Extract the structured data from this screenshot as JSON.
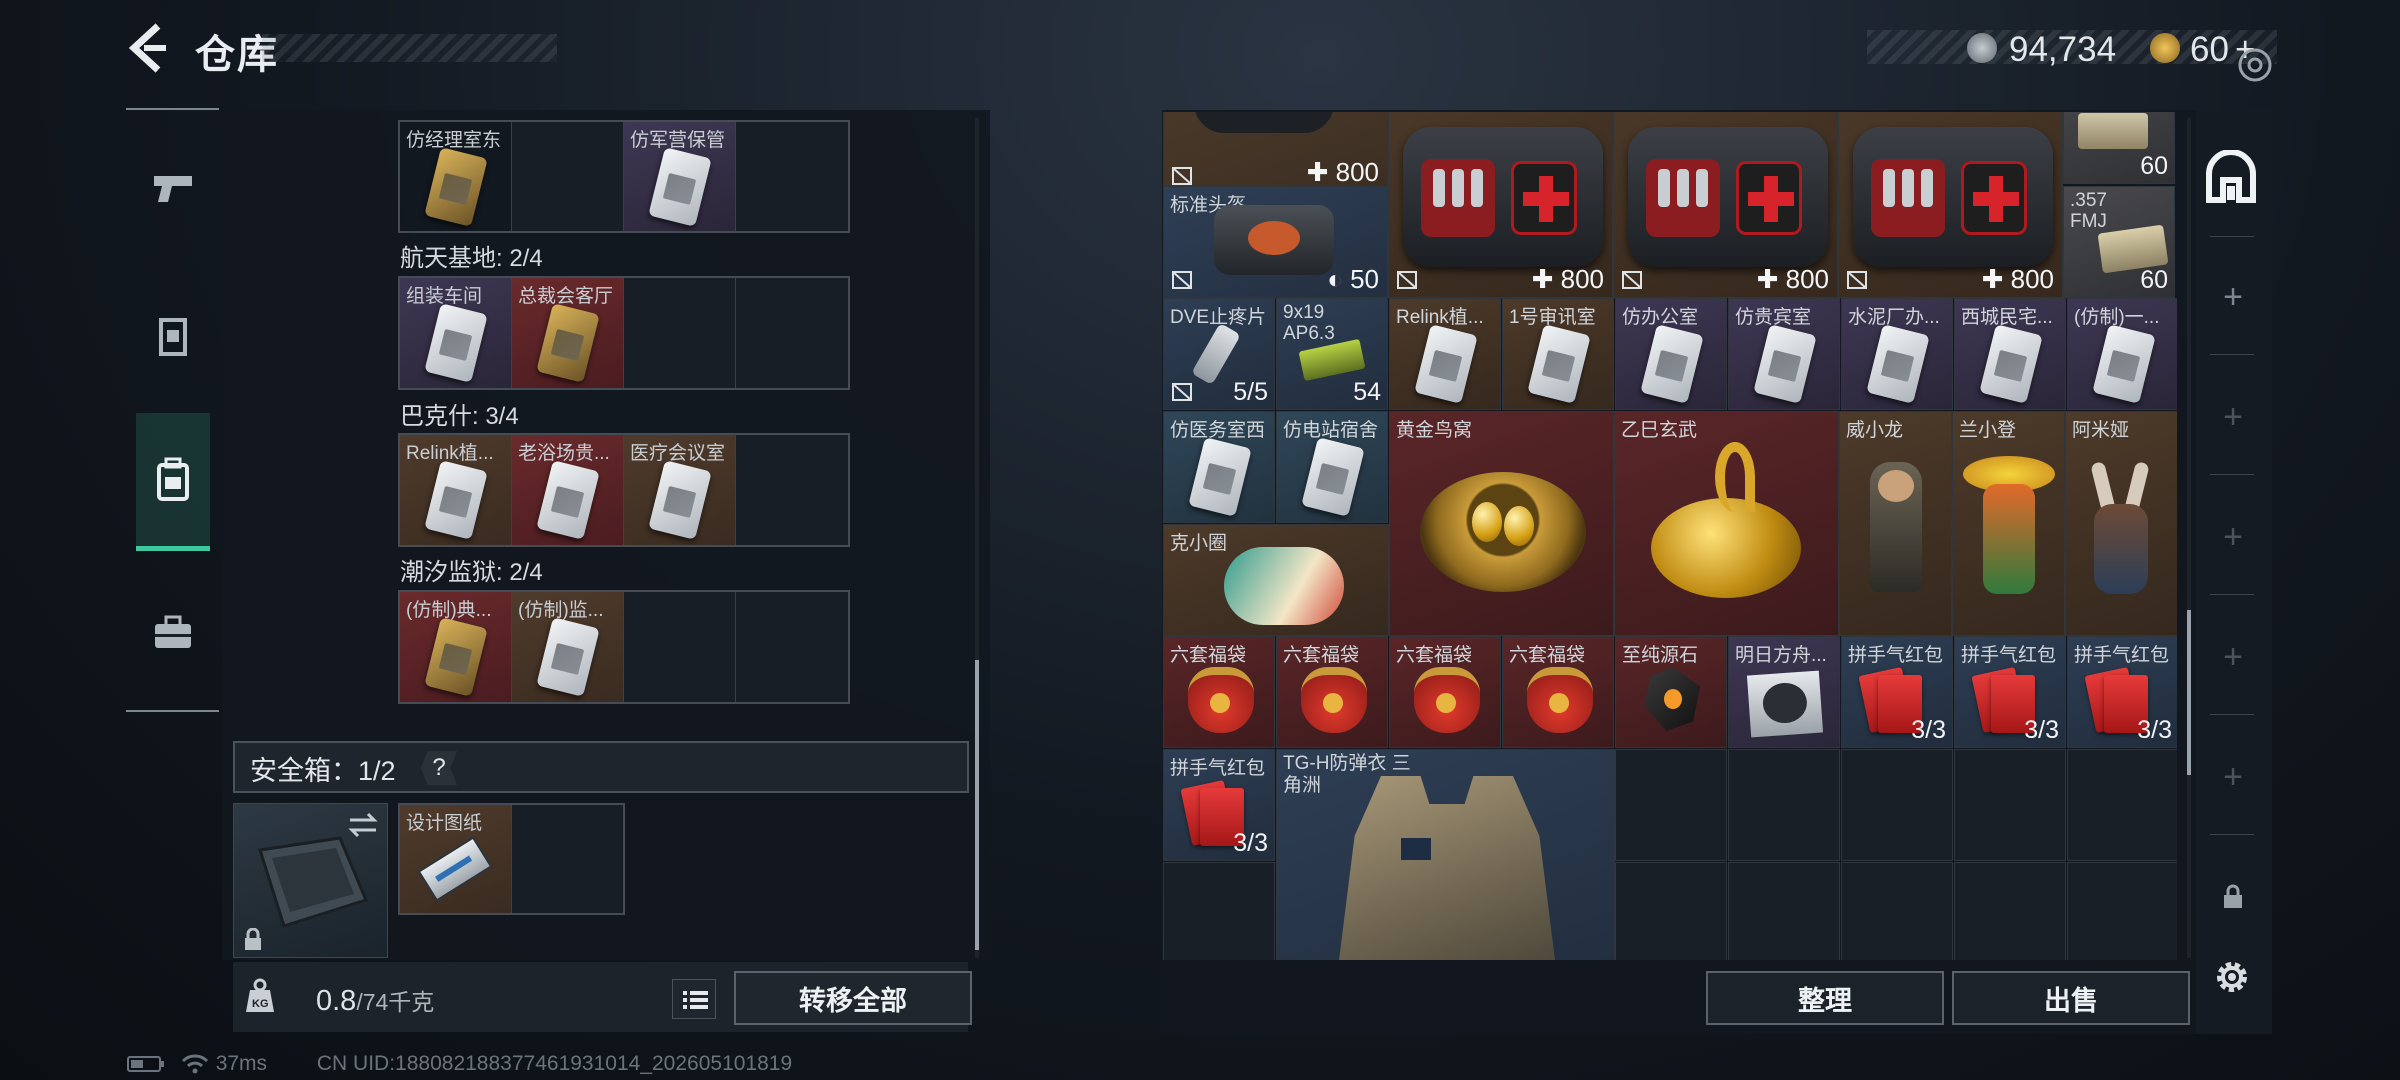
{
  "header": {
    "title": "仓库",
    "currency_primary": "94,734",
    "currency_secondary": "60",
    "add_label": "+"
  },
  "left_panel": {
    "top_row": [
      {
        "label": "仿经理室东",
        "color": "red",
        "card": "gold"
      },
      {
        "label": "",
        "color": "dark"
      },
      {
        "label": "仿军营保管",
        "color": "purple",
        "card": "white"
      },
      {
        "label": "",
        "color": "dark"
      }
    ],
    "groups": [
      {
        "title": "航天基地: 2/4",
        "items": [
          {
            "label": "组装车间",
            "color": "purple",
            "card": "white"
          },
          {
            "label": "总裁会客厅",
            "color": "red",
            "card": "gold"
          },
          {
            "label": "",
            "color": "dark"
          },
          {
            "label": "",
            "color": "dark"
          }
        ]
      },
      {
        "title": "巴克什: 3/4",
        "items": [
          {
            "label": "Relink植...",
            "color": "brown",
            "card": "white"
          },
          {
            "label": "老浴场贵...",
            "color": "red",
            "card": "white"
          },
          {
            "label": "医疗会议室",
            "color": "brown",
            "card": "white"
          },
          {
            "label": "",
            "color": "dark"
          }
        ]
      },
      {
        "title": "潮汐监狱: 2/4",
        "items": [
          {
            "label": "(仿制)典...",
            "color": "red",
            "card": "gold"
          },
          {
            "label": "(仿制)监...",
            "color": "brown",
            "card": "white"
          },
          {
            "label": "",
            "color": "dark"
          },
          {
            "label": "",
            "color": "dark"
          }
        ]
      }
    ],
    "safe_box": {
      "label": "安全箱：1/2",
      "help": "?"
    },
    "blueprint": {
      "label": "设计图纸"
    },
    "weight": {
      "current": "0.8",
      "max": "/74千克"
    },
    "transfer_all": "转移全部"
  },
  "right_panel": {
    "cells": [
      {
        "label": "",
        "num": "800",
        "kind": "partial-top"
      },
      {
        "label": "标准头盔",
        "num": "50"
      },
      {
        "label": "",
        "num": "800",
        "kind": "firstaid"
      },
      {
        "label": "",
        "num": "800",
        "kind": "firstaid"
      },
      {
        "label": "",
        "num": "800",
        "kind": "firstaid"
      },
      {
        "label": "",
        "num": "60"
      },
      {
        "label": ".357 FMJ",
        "num": "60"
      },
      {
        "label": "DVE止疼片",
        "num": "5/5"
      },
      {
        "label": "9x19 AP6.3",
        "num": "54"
      },
      {
        "label": "Relink植..."
      },
      {
        "label": "1号审讯室"
      },
      {
        "label": "仿办公室"
      },
      {
        "label": "仿贵宾室"
      },
      {
        "label": "水泥厂办..."
      },
      {
        "label": "西城民宅..."
      },
      {
        "label": "(仿制)一..."
      },
      {
        "label": "仿医务室西"
      },
      {
        "label": "仿电站宿舍"
      },
      {
        "label": "黄金鸟窝"
      },
      {
        "label": "乙巳玄武"
      },
      {
        "label": "威小龙"
      },
      {
        "label": "兰小登"
      },
      {
        "label": "阿米娅"
      },
      {
        "label": "克小圈"
      },
      {
        "label": "六套福袋"
      },
      {
        "label": "六套福袋"
      },
      {
        "label": "六套福袋"
      },
      {
        "label": "六套福袋"
      },
      {
        "label": "至纯源石"
      },
      {
        "label": "明日方舟..."
      },
      {
        "label": "拼手气红包",
        "num": "3/3"
      },
      {
        "label": "拼手气红包",
        "num": "3/3"
      },
      {
        "label": "拼手气红包",
        "num": "3/3"
      },
      {
        "label": "拼手气红包",
        "num": "3/3"
      },
      {
        "label": "TG-H防弹衣 三角洲"
      }
    ],
    "sort_button": "整理",
    "sell_button": "出售"
  },
  "status_bar": {
    "ping": "37ms",
    "uid": "CN UID:1880821883774619310​14_202605101819"
  }
}
